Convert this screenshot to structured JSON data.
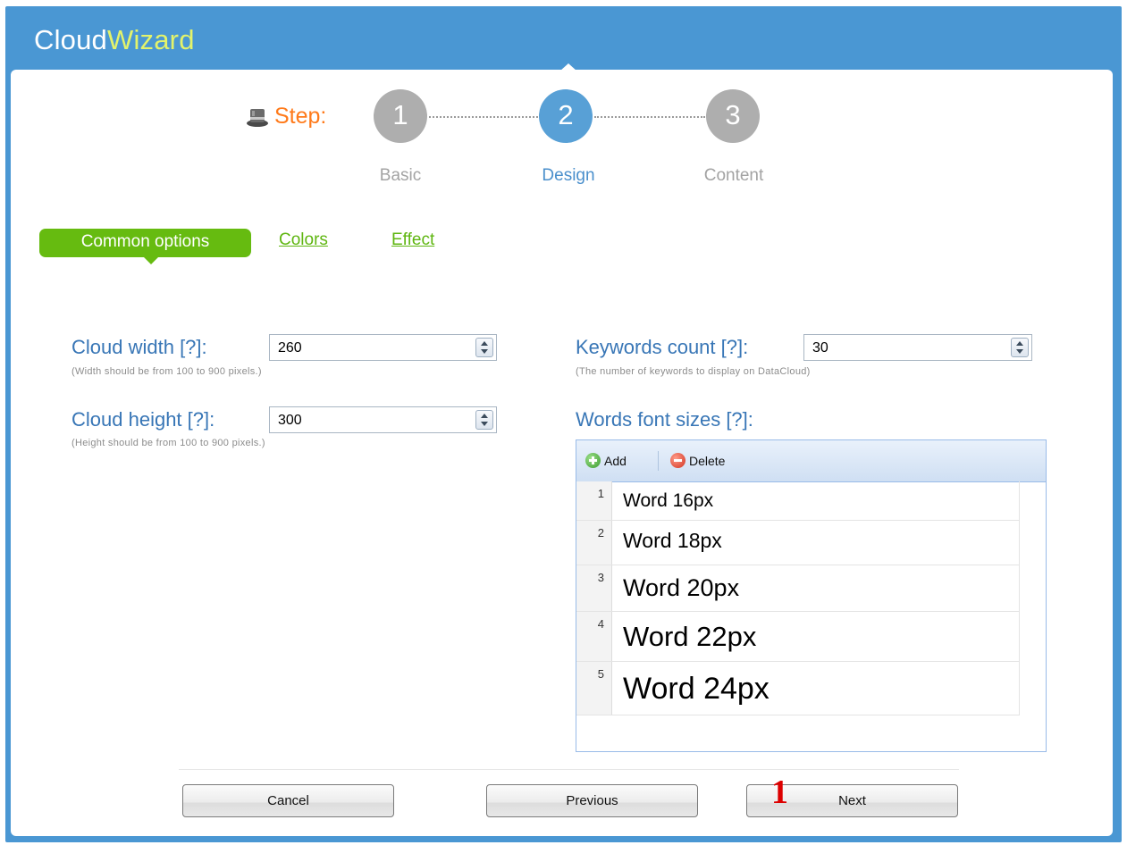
{
  "app": {
    "title_part1": "Cloud",
    "title_part2": "Wizard"
  },
  "stepper": {
    "label": "Step:",
    "steps": [
      {
        "number": "1",
        "name": "Basic",
        "state": "inactive"
      },
      {
        "number": "2",
        "name": "Design",
        "state": "active"
      },
      {
        "number": "3",
        "name": "Content",
        "state": "inactive"
      }
    ]
  },
  "tabs": [
    {
      "label": "Common options",
      "active": true
    },
    {
      "label": "Colors",
      "active": false
    },
    {
      "label": "Effect",
      "active": false
    }
  ],
  "form": {
    "cloud_width": {
      "label": "Cloud width [?]:",
      "value": "260",
      "hint": "(Width should be from 100 to 900 pixels.)"
    },
    "cloud_height": {
      "label": "Cloud height [?]:",
      "value": "300",
      "hint": "(Height should be from 100 to 900 pixels.)"
    },
    "keywords_count": {
      "label": "Keywords count [?]:",
      "value": "30",
      "hint": "(The number of keywords to display on DataCloud)"
    },
    "font_sizes": {
      "label": "Words font sizes [?]:",
      "add_label": "Add",
      "delete_label": "Delete",
      "rows": [
        {
          "num": "1",
          "text": "Word 16px"
        },
        {
          "num": "2",
          "text": "Word 18px"
        },
        {
          "num": "3",
          "text": "Word 20px"
        },
        {
          "num": "4",
          "text": "Word 22px"
        },
        {
          "num": "5",
          "text": "Word 24px"
        }
      ]
    }
  },
  "buttons": {
    "cancel": "Cancel",
    "previous": "Previous",
    "next": "Next"
  },
  "annotation_marker": "1",
  "colors": {
    "header_blue": "#4a97d3",
    "step_orange": "#ff7a1a",
    "tab_green": "#66bb10",
    "label_blue": "#3876b6"
  }
}
